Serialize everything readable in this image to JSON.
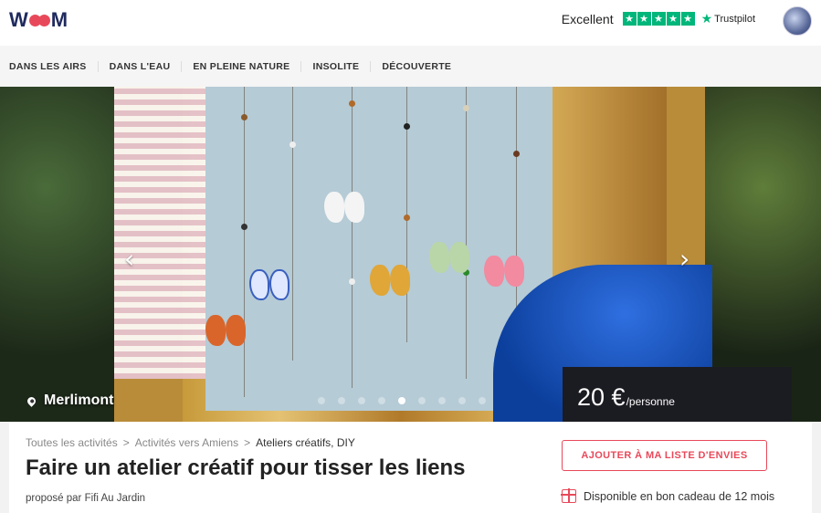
{
  "header": {
    "logo_text": "WOM",
    "trust_label": "Excellent",
    "trust_brand": "Trustpilot"
  },
  "nav": {
    "items": [
      "DANS LES AIRS",
      "DANS L'EAU",
      "EN PLEINE NATURE",
      "INSOLITE",
      "DÉCOUVERTE"
    ]
  },
  "hero": {
    "location": "Merlimont",
    "price_amount": "20 €",
    "price_unit": "/personne",
    "slide_count": 10,
    "active_slide": 5
  },
  "breadcrumb": {
    "items": [
      "Toutes les activités",
      "Activités vers Amiens",
      "Ateliers créatifs, DIY"
    ],
    "separator": ">"
  },
  "activity": {
    "title": "Faire un atelier créatif pour tisser les liens",
    "byline": "proposé par Fifi Au Jardin"
  },
  "actions": {
    "wishlist_label": "AJOUTER À MA LISTE D'ENVIES",
    "gift_text": "Disponible en bon cadeau de 12 mois"
  },
  "colors": {
    "brand_pink": "#e8495a",
    "brand_navy": "#1f2a5e",
    "trustpilot_green": "#00b67a"
  }
}
